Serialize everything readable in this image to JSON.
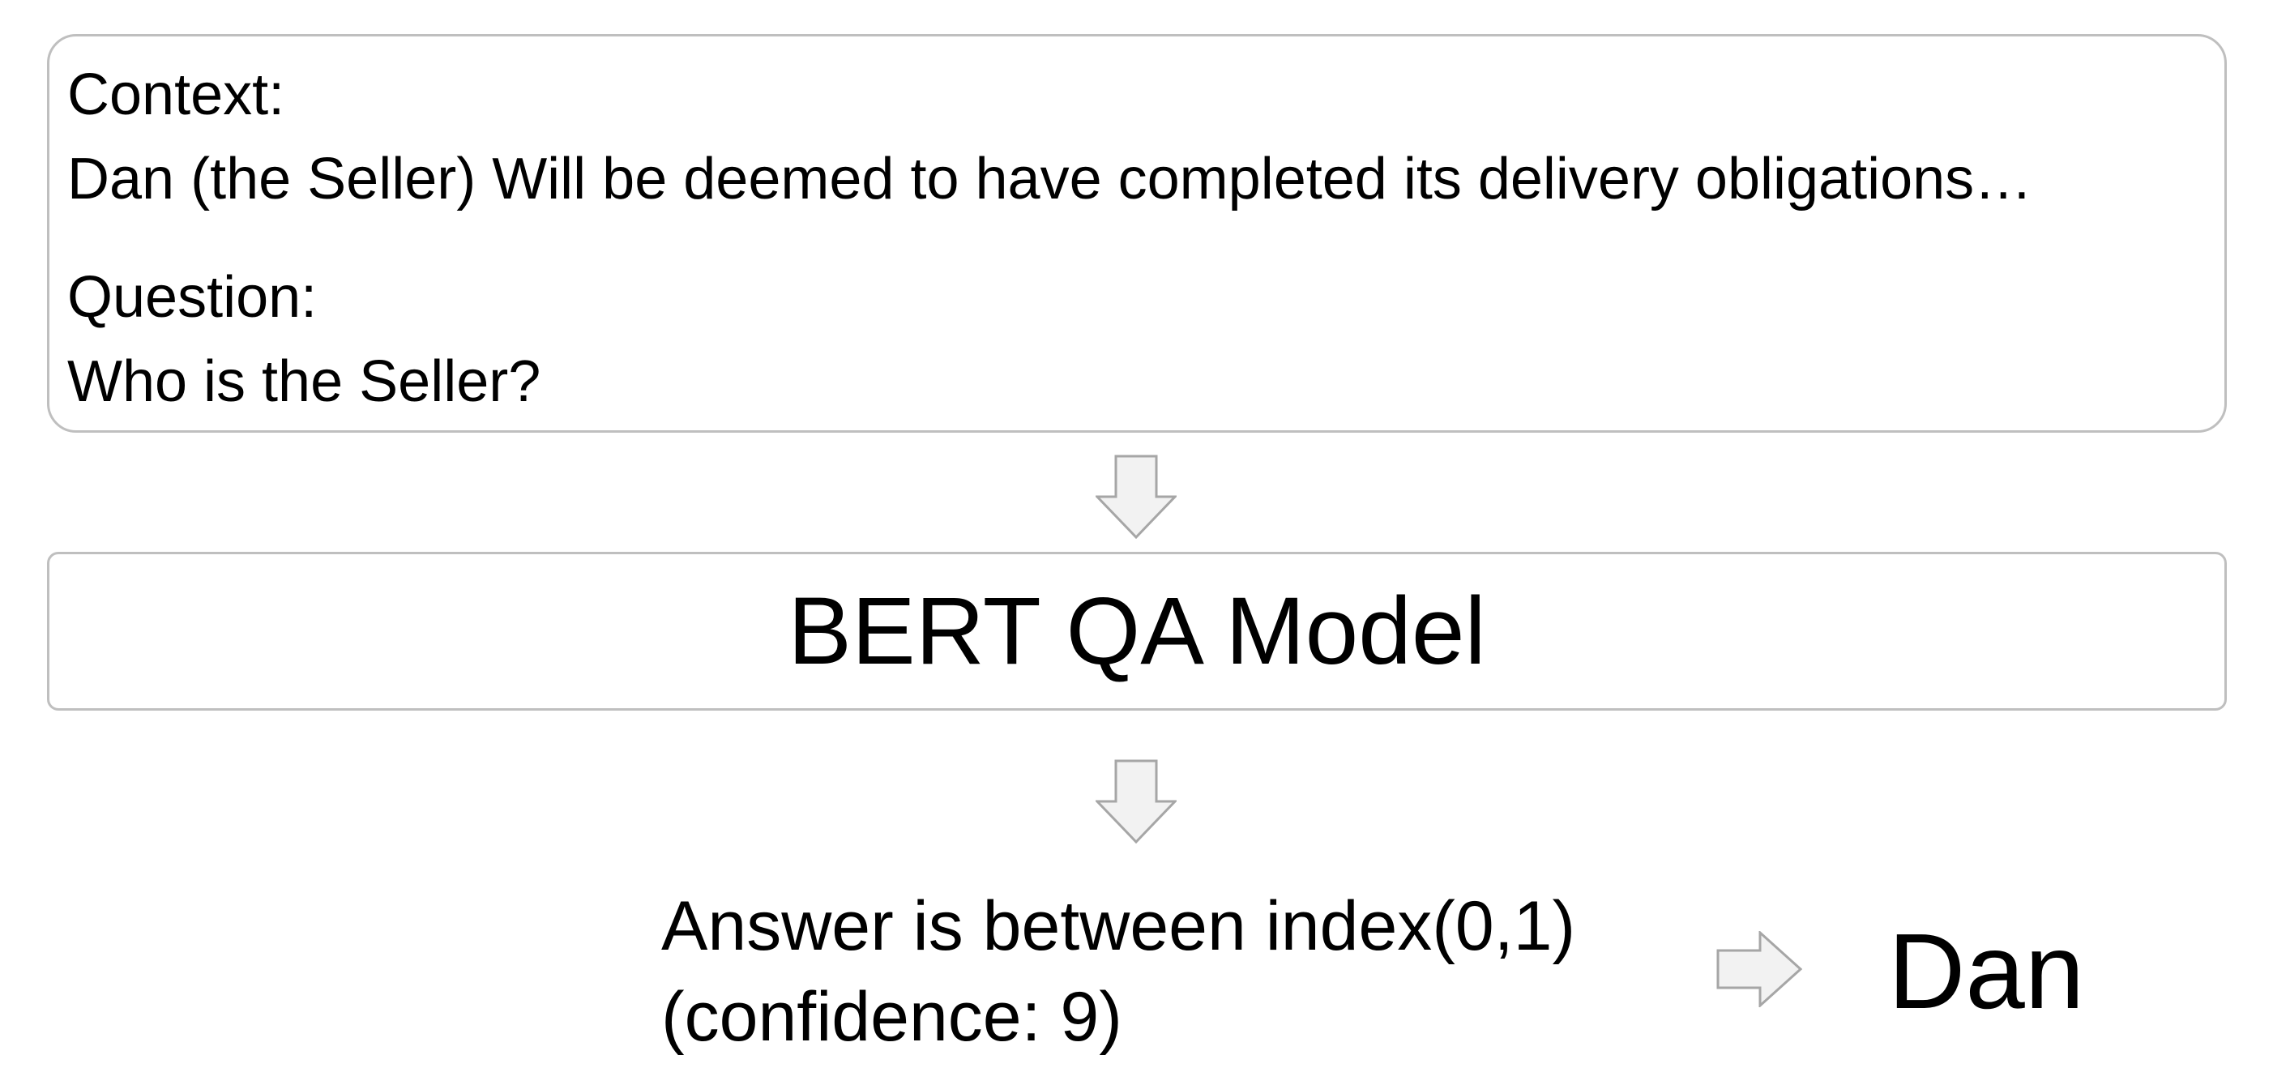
{
  "input": {
    "context_label": "Context:",
    "context_text": "Dan (the Seller) Will be deemed to have completed its delivery obligations…",
    "question_label": "Question:",
    "question_text": "Who is the Seller?"
  },
  "model": {
    "label": "BERT QA Model"
  },
  "output": {
    "answer_line": "Answer is between index(0,1)",
    "confidence_line": "(confidence: 9)",
    "result": "Dan"
  },
  "colors": {
    "border": "#bfbfbf",
    "arrow_fill": "#f2f2f2",
    "arrow_stroke": "#a6a6a6",
    "text": "#000000"
  },
  "icons": [
    "arrow-down-icon",
    "arrow-right-icon"
  ]
}
